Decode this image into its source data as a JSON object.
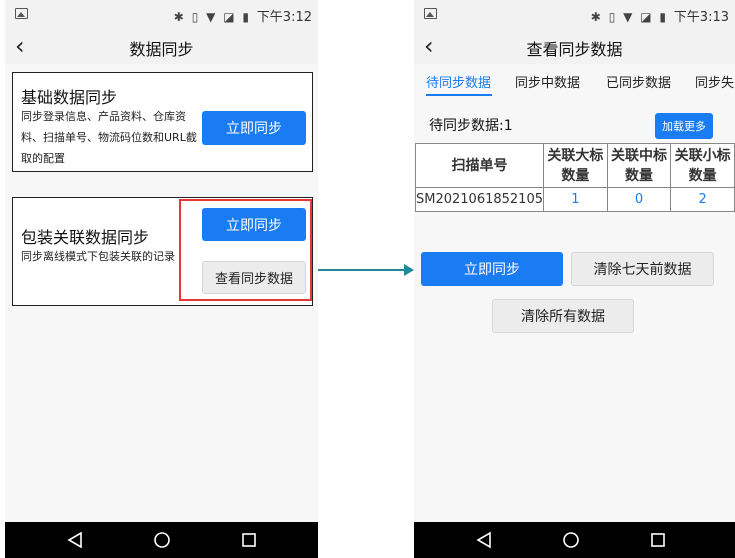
{
  "status_bar": {
    "left_time": "下午3:12",
    "right_time": "下午3:13",
    "icons": [
      "image-icon",
      "bluetooth-icon",
      "vibrate-icon",
      "wifi-icon",
      "no-sim-icon",
      "battery-icon"
    ]
  },
  "left_screen": {
    "title": "数据同步",
    "card1": {
      "title": "基础数据同步",
      "desc_line1": "同步登录信息、产品资料、仓库资",
      "desc_line2": "料、扫描单号、物流码位数和URL截",
      "desc_line3": "取的配置",
      "button": "立即同步"
    },
    "card2": {
      "title": "包装关联数据同步",
      "desc": "同步离线模式下包装关联的记录",
      "button_primary": "立即同步",
      "button_secondary": "查看同步数据"
    }
  },
  "right_screen": {
    "title": "查看同步数据",
    "tabs": [
      {
        "label": "待同步数据",
        "active": true
      },
      {
        "label": "同步中数据",
        "active": false
      },
      {
        "label": "已同步数据",
        "active": false
      },
      {
        "label": "同步失",
        "active": false
      }
    ],
    "pending_label": "待同步数据:1",
    "load_more": "加载更多",
    "table": {
      "headers": [
        "扫描单号",
        "关联大标数量",
        "关联中标数量",
        "关联小标数量"
      ],
      "header_lines": [
        [
          "扫描单号"
        ],
        [
          "关联大标",
          "数量"
        ],
        [
          "关联中标",
          "数量"
        ],
        [
          "关联小标",
          "数量"
        ]
      ],
      "rows": [
        [
          "SM2021061852105",
          "1",
          "0",
          "2"
        ]
      ]
    },
    "buttons": {
      "sync_now": "立即同步",
      "clear_seven_days": "清除七天前数据",
      "clear_all": "清除所有数据"
    }
  },
  "colors": {
    "primary": "#1a7cf2",
    "highlight": "#e53935",
    "arrow": "#1f8a99"
  }
}
